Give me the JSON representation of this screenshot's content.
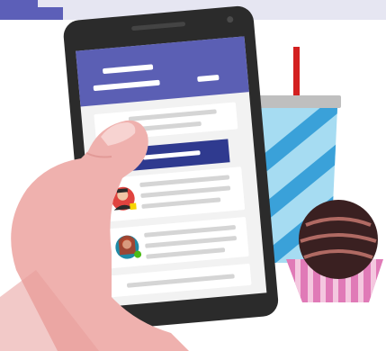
{
  "colors": {
    "top_band": "#e6e6f2",
    "top_accent": "#5c5fb8",
    "phone_body": "#2b2b2b",
    "screen_bg": "#f2f2f2",
    "header_purple": "#5b5fb4",
    "highlight_bar": "#2f3a8f",
    "placeholder_line": "#d5d5d5",
    "card_bg": "#ffffff",
    "hand_skin": "#efb1ae",
    "sleeve": "#e89c9b",
    "cup_blue": "#a6dcf2",
    "cup_stripe": "#3aa1d9",
    "straw": "#d32020",
    "muffin_cup": "#e07ab7",
    "muffin_stripe": "#f4c7df",
    "chocolate": "#3a2021",
    "chocolate_swirl": "#b06a63",
    "presence_online": "#4cbb17",
    "presence_away": "#f7d400"
  },
  "icons": {
    "avatar_one": "person-avatar-icon",
    "avatar_two": "person-avatar-icon"
  }
}
